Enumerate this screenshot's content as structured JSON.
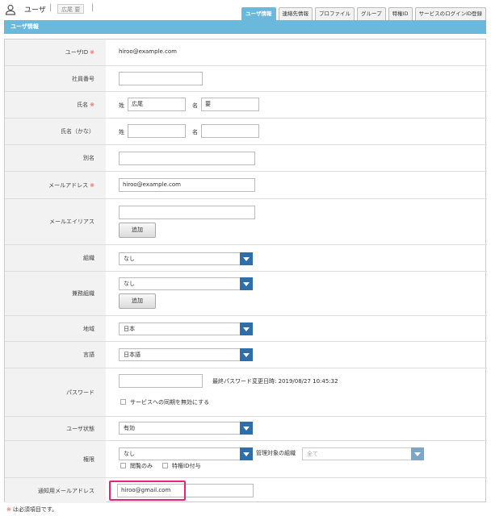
{
  "header": {
    "title": "ユーザ",
    "separator": "|",
    "user_name": "広尾 要",
    "tabs": [
      "ユーザ情報",
      "連絡先情報",
      "プロファイル",
      "グループ",
      "特権ID",
      "サービスのログインID登録"
    ]
  },
  "section": {
    "title": "ユーザ情報"
  },
  "required_mark": "※",
  "fields": {
    "user_id": {
      "label": "ユーザID",
      "value": "hiroo@example.com"
    },
    "employee_no": {
      "label": "社員番号",
      "value": ""
    },
    "name": {
      "label": "氏名",
      "last_label": "姓",
      "last_value": "広尾",
      "first_label": "名",
      "first_value": "要"
    },
    "name_kana": {
      "label": "氏名（かな）",
      "last_label": "姓",
      "last_value": "",
      "first_label": "名",
      "first_value": ""
    },
    "alias": {
      "label": "別名",
      "value": ""
    },
    "email": {
      "label": "メールアドレス",
      "value": "hiroo@example.com"
    },
    "mail_alias": {
      "label": "メールエイリアス",
      "value": "",
      "add_button": "追加"
    },
    "organization": {
      "label": "組織",
      "value": "なし"
    },
    "concurrent_org": {
      "label": "兼務組織",
      "value": "なし",
      "add_button": "追加"
    },
    "region": {
      "label": "地域",
      "value": "日本"
    },
    "language": {
      "label": "言語",
      "value": "日本語"
    },
    "password": {
      "label": "パスワード",
      "value": "",
      "last_changed": "最終パスワード変更日時: 2019/08/27 10:45:32",
      "sync_disable": "サービスへの同期を無効にする"
    },
    "user_status": {
      "label": "ユーザ状態",
      "value": "有効"
    },
    "authority": {
      "label": "権限",
      "value": "なし",
      "managed_org_label": "管理対象の組織",
      "managed_org_value": "全て",
      "view_only": "閲覧のみ",
      "privileged_id": "特権ID付与"
    },
    "notify_email": {
      "label": "通知用メールアドレス",
      "value": "hiroo@gmail.com"
    }
  },
  "footnote": "は必須項目です。",
  "colors": {
    "accent": "#6ab9dc",
    "select_arrow": "#2f6ea8",
    "required": "#e8463b",
    "highlight": "#e5237a"
  }
}
